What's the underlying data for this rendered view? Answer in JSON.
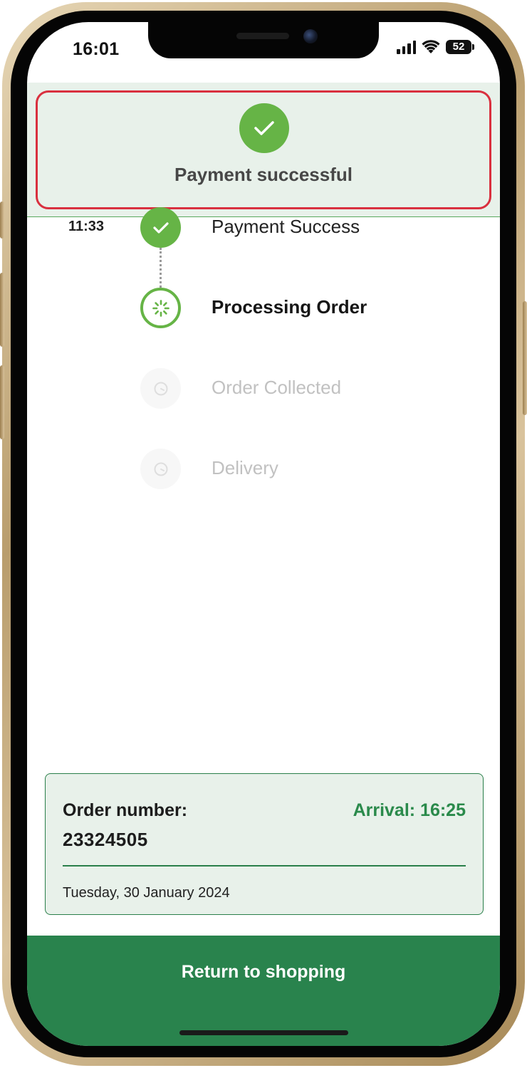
{
  "status_bar": {
    "time": "16:01",
    "battery": "52",
    "icons": [
      "cellular-signal-icon",
      "wifi-icon",
      "battery-icon"
    ]
  },
  "banner": {
    "icon": "check-icon",
    "message": "Payment successful"
  },
  "timeline": {
    "steps": [
      {
        "time": "11:33",
        "label": "Payment Success",
        "state": "completed",
        "icon": "check-icon"
      },
      {
        "time": "",
        "label": "Processing Order",
        "state": "in-progress",
        "icon": "loading-spinner-icon"
      },
      {
        "time": "",
        "label": "Order Collected",
        "state": "pending",
        "icon": "clock-icon"
      },
      {
        "time": "",
        "label": "Delivery",
        "state": "pending",
        "icon": "clock-icon"
      }
    ]
  },
  "order": {
    "number_label": "Order number:",
    "number": "23324505",
    "arrival": "Arrival: 16:25",
    "date": "Tuesday, 30 January 2024"
  },
  "actions": {
    "return_label": "Return to shopping"
  },
  "colors": {
    "brand_green": "#29834d",
    "success_green": "#66b446",
    "banner_bg": "#e8f1ea",
    "highlight_border": "#d9303f",
    "arrival_text": "#2a8a4b",
    "pending_text": "#c1c1c1"
  }
}
